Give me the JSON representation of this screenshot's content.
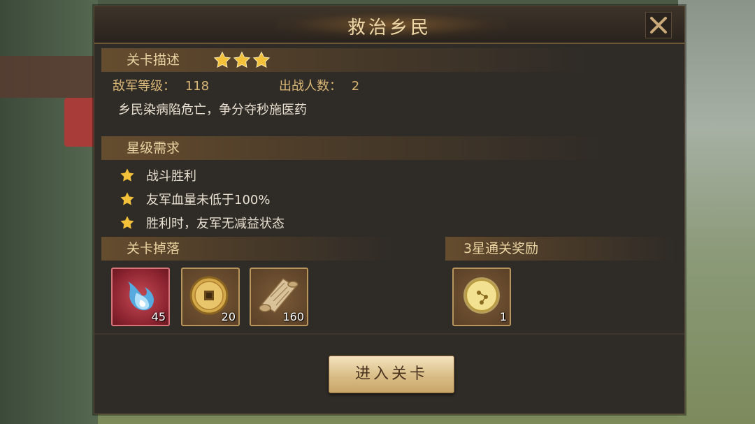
{
  "window": {
    "title": "救治乡民"
  },
  "stage": {
    "section_label": "关卡描述",
    "stars": 3,
    "enemy_level_label": "敌军等级：",
    "enemy_level_value": "118",
    "troops_label": "出战人数：",
    "troops_value": "2",
    "description": "乡民染病陷危亡，争分夺秒施医药"
  },
  "requirements": {
    "section_label": "星级需求",
    "items": [
      {
        "text": "战斗胜利"
      },
      {
        "text": "友军血量未低于100%"
      },
      {
        "text": "胜利时，友军无减益状态"
      }
    ]
  },
  "drops": {
    "section_label": "关卡掉落",
    "items": [
      {
        "icon": "blue-flame-crystal-icon",
        "quantity": "45"
      },
      {
        "icon": "gold-coin-icon",
        "quantity": "20"
      },
      {
        "icon": "scroll-icon",
        "quantity": "160"
      }
    ]
  },
  "rewards": {
    "section_label": "3星通关奖励",
    "items": [
      {
        "icon": "golden-orb-icon",
        "quantity": "1"
      }
    ]
  },
  "actions": {
    "enter_label": "进入关卡"
  },
  "colors": {
    "accent": "#d9b776",
    "panel": "#2f2b27",
    "button": "#e6cf9f",
    "star": "#f3c23a"
  }
}
